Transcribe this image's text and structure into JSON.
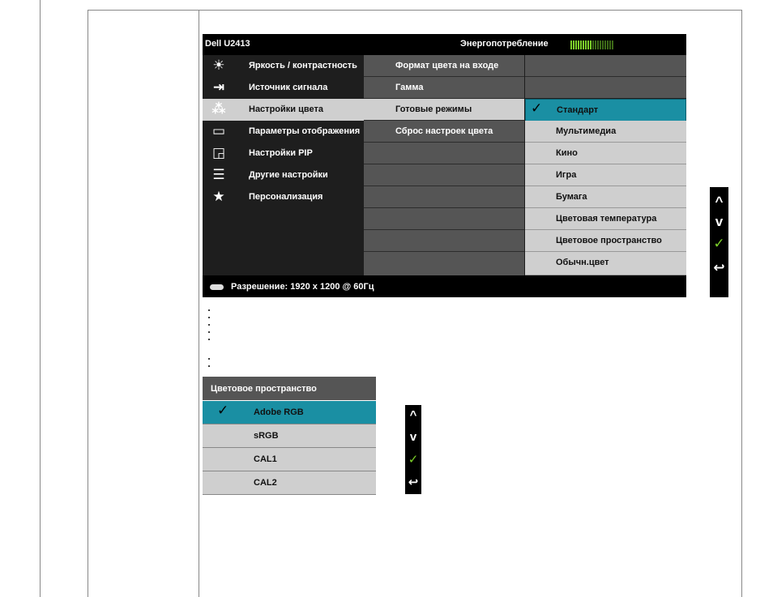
{
  "osd": {
    "model": "Dell U2413",
    "power_label": "Энергопотребление",
    "power_level": 0.5,
    "menu": [
      {
        "icon": "brightness-contrast-icon",
        "glyph": "☀",
        "label": "Яркость / контрастность"
      },
      {
        "icon": "input-source-icon",
        "glyph": "⇥",
        "label": "Источник сигнала"
      },
      {
        "icon": "color-settings-icon",
        "glyph": "⁂",
        "label": "Настройки цвета"
      },
      {
        "icon": "display-settings-icon",
        "glyph": "▭",
        "label": "Параметры отображения"
      },
      {
        "icon": "pip-settings-icon",
        "glyph": "◲",
        "label": "Настройки PIP"
      },
      {
        "icon": "other-settings-icon",
        "glyph": "☰",
        "label": "Другие настройки"
      },
      {
        "icon": "personalize-star-icon",
        "glyph": "★",
        "label": "Персонализация"
      }
    ],
    "color_submenu": [
      "Формат цвета на входе",
      "Гамма",
      "Готовые режимы",
      "Сброс настроек цвета"
    ],
    "preset_modes": [
      "Стандарт",
      "Мультимедиа",
      "Кино",
      "Игра",
      "Бумага",
      "Цветовая температура",
      "Цветовое пространство",
      "Обычн.цвет"
    ],
    "footer": "Разрешение: 1920 x 1200 @ 60Гц"
  },
  "buttons": {
    "up": "^",
    "down": "v",
    "ok": "✓",
    "back": "↩"
  },
  "color_space": {
    "title": "Цветовое пространство",
    "options": [
      "Adobe RGB",
      "sRGB",
      "CAL1",
      "CAL2"
    ]
  }
}
